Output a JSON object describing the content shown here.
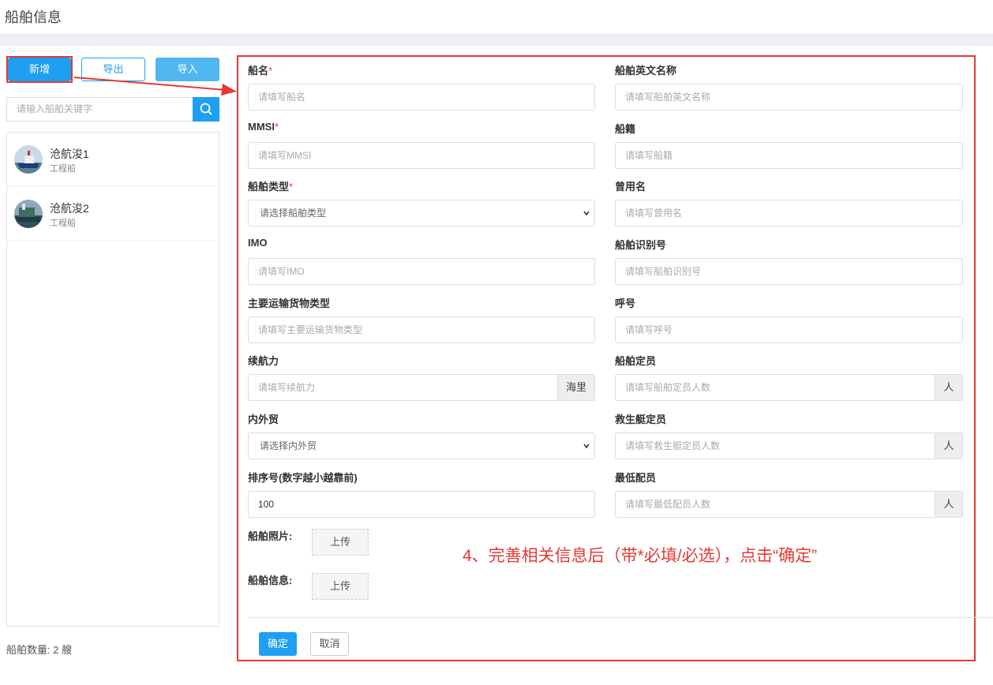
{
  "page": {
    "title": "船舶信息"
  },
  "toolbar": {
    "add_label": "新增",
    "export_label": "导出",
    "import_label": "导入"
  },
  "search": {
    "placeholder": "请输入船舶关键字",
    "icon": "search-icon"
  },
  "ships": [
    {
      "name": "沧航浚1",
      "type": "工程船"
    },
    {
      "name": "沧航浚2",
      "type": "工程船"
    }
  ],
  "ship_count": "船舶数量: 2 艘",
  "form": {
    "ship_name": {
      "label": "船名",
      "required": "*",
      "placeholder": "请填写船名"
    },
    "english_name": {
      "label": "船舶英文名称",
      "placeholder": "请填写船舶英文名称"
    },
    "mmsi": {
      "label": "MMSI",
      "required": "*",
      "placeholder": "请填写MMSI"
    },
    "nationality": {
      "label": "船籍",
      "placeholder": "请填写船籍"
    },
    "ship_type": {
      "label": "船舶类型",
      "required": "*",
      "placeholder": "请选择船舶类型"
    },
    "former_name": {
      "label": "曾用名",
      "placeholder": "请填写曾用名"
    },
    "imo": {
      "label": "IMO",
      "placeholder": "请填写IMO"
    },
    "identification": {
      "label": "船舶识别号",
      "placeholder": "请填写船舶识别号"
    },
    "cargo_type": {
      "label": "主要运输货物类型",
      "placeholder": "请填写主要运输货物类型"
    },
    "call_sign": {
      "label": "呼号",
      "placeholder": "请填写呼号"
    },
    "endurance": {
      "label": "续航力",
      "placeholder": "请填写续航力",
      "unit": "海里"
    },
    "crew_quota": {
      "label": "船舶定员",
      "placeholder": "请填写船舶定员人数",
      "unit": "人"
    },
    "trade": {
      "label": "内外贸",
      "placeholder": "请选择内外贸"
    },
    "lifeboat": {
      "label": "救生艇定员",
      "placeholder": "请填写救生艇定员人数",
      "unit": "人"
    },
    "sort_order": {
      "label": "排序号(数字越小越靠前)",
      "value": "100"
    },
    "min_crew": {
      "label": "最低配员",
      "placeholder": "请填写最低配员人数",
      "unit": "人"
    },
    "photo": {
      "label": "船舶照片:",
      "button": "上传"
    },
    "info": {
      "label": "船舶信息:",
      "button": "上传"
    },
    "confirm_label": "确定",
    "cancel_label": "取消"
  },
  "annotation": "4、完善相关信息后（带*必填/必选），点击“确定”",
  "colors": {
    "primary": "#1e9ff2",
    "highlight": "#e53935"
  }
}
